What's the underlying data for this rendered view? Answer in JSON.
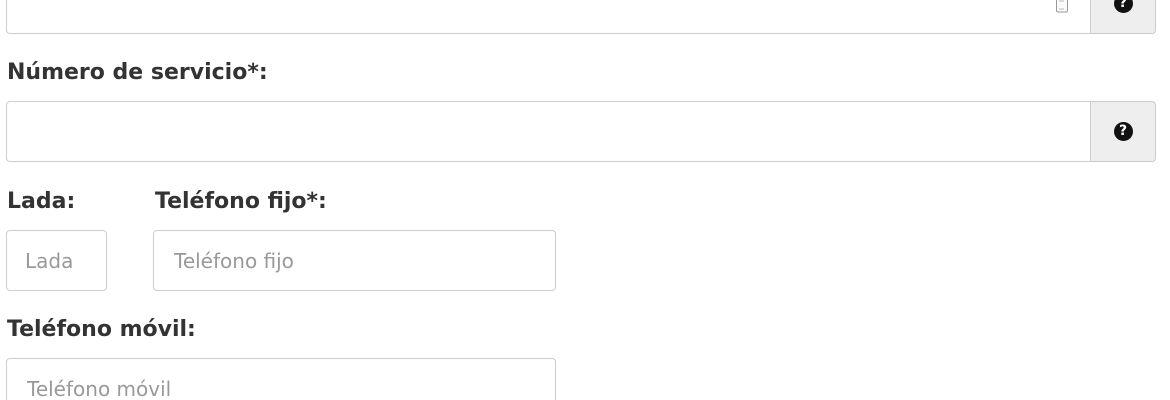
{
  "top_field": {
    "value": "",
    "help_icon": "question-circle-icon",
    "clipboard_icon": "clipboard-icon",
    "help_glyph": "?"
  },
  "servicio": {
    "label": "Número de servicio*:",
    "value": "",
    "help_icon": "question-circle-icon",
    "help_glyph": "?"
  },
  "lada": {
    "label": "Lada:",
    "placeholder": "Lada"
  },
  "telefono_fijo": {
    "label": "Teléfono fijo*:",
    "placeholder": "Teléfono fijo"
  },
  "telefono_movil": {
    "label": "Teléfono móvil:",
    "placeholder": "Teléfono móvil"
  }
}
